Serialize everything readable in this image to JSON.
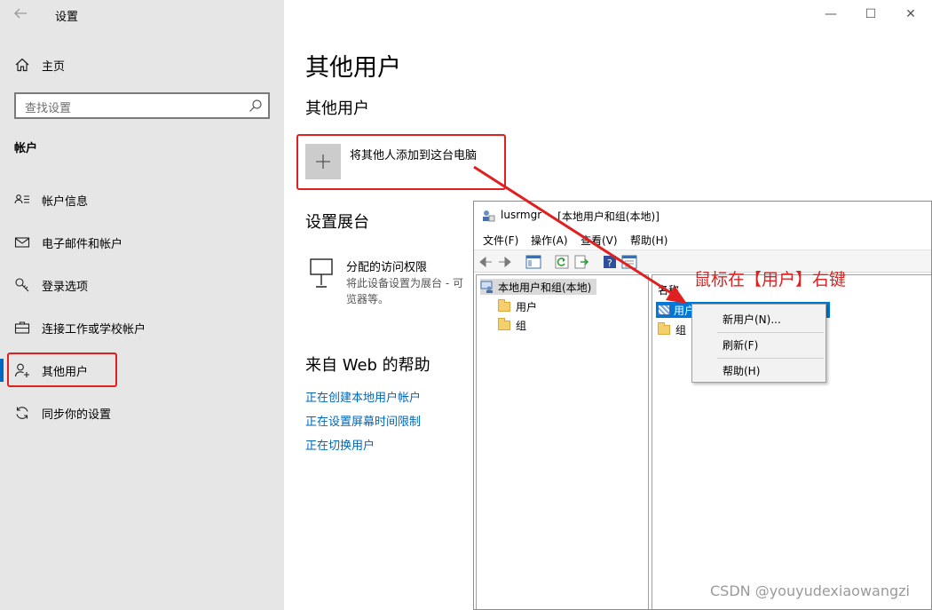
{
  "window": {
    "title": "设置",
    "minimize": "—",
    "maximize": "☐",
    "close": "✕"
  },
  "sidebar": {
    "back_icon": "back-arrow-icon",
    "home": "主页",
    "search_placeholder": "查找设置",
    "section": "帐户",
    "items": [
      {
        "label": "帐户信息",
        "icon": "person-card-icon"
      },
      {
        "label": "电子邮件和帐户",
        "icon": "mail-icon"
      },
      {
        "label": "登录选项",
        "icon": "key-icon"
      },
      {
        "label": "连接工作或学校帐户",
        "icon": "briefcase-icon"
      },
      {
        "label": "其他用户",
        "icon": "person-add-icon",
        "selected": true
      },
      {
        "label": "同步你的设置",
        "icon": "sync-icon"
      }
    ]
  },
  "main": {
    "page_title": "其他用户",
    "other_users_heading": "其他用户",
    "add_user_label": "将其他人添加到这台电脑",
    "kiosk_heading": "设置展台",
    "kiosk_title": "分配的访问权限",
    "kiosk_desc_line1": "将此设备设置为展台 - 可",
    "kiosk_desc_line2": "览器等。",
    "web_help_heading": "来自 Web 的帮助",
    "links": [
      "正在创建本地用户帐户",
      "正在设置屏幕时间限制",
      "正在切换用户"
    ]
  },
  "mmc": {
    "app_name": "lusrmgr",
    "title": "- [本地用户和组(本地)]",
    "menus": [
      "文件(F)",
      "操作(A)",
      "查看(V)",
      "帮助(H)"
    ],
    "tree_root": "本地用户和组(本地)",
    "tree_children": [
      "用户",
      "组"
    ],
    "list_column": "名称",
    "list_items": [
      "用户",
      "组"
    ]
  },
  "context_menu": {
    "items": [
      "新用户(N)...",
      "刷新(F)",
      "帮助(H)"
    ]
  },
  "annotation": "鼠标在【用户】右键",
  "watermark": "CSDN @youyudexiaowangzi",
  "colors": {
    "accent": "#0067c0",
    "link": "#0067b8",
    "annotation_red": "#e02020",
    "sidebar_bg": "#e6e6e6"
  }
}
